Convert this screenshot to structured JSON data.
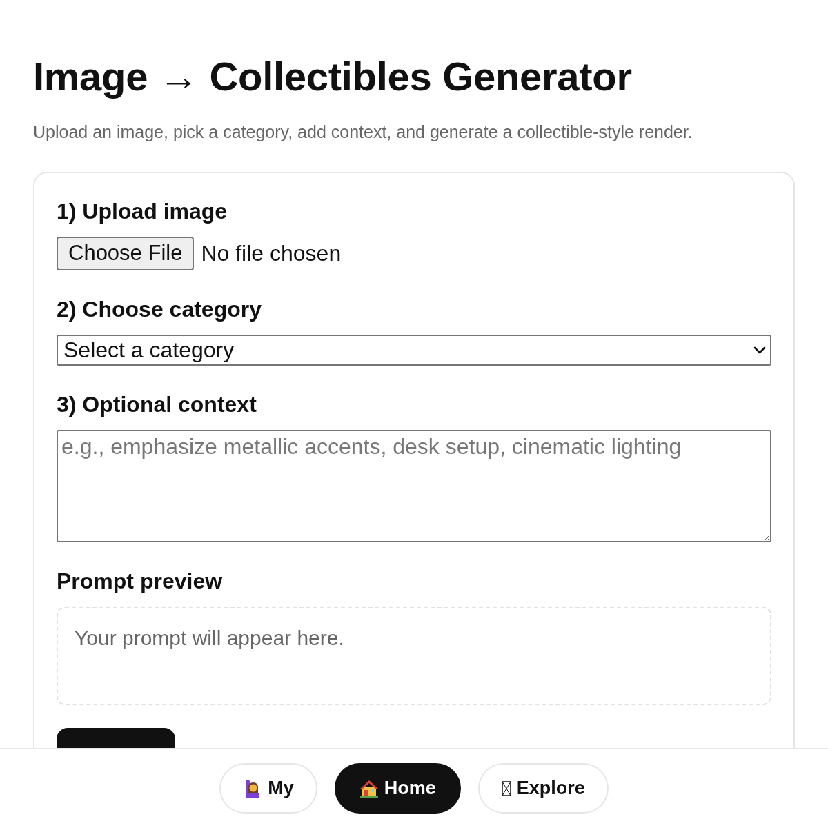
{
  "page": {
    "title": "Image → Collectibles Generator",
    "subtitle": "Upload an image, pick a category, add context, and generate a collectible-style render."
  },
  "form": {
    "upload": {
      "label": "1) Upload image",
      "button": "Choose File",
      "status": "No file chosen"
    },
    "category": {
      "label": "2) Choose category",
      "value": "Select a category"
    },
    "context": {
      "label": "3) Optional context",
      "placeholder": "e.g., emphasize metallic accents, desk setup, cinematic lighting"
    },
    "preview": {
      "label": "Prompt preview",
      "text": "Your prompt will appear here."
    }
  },
  "bottom_nav": [
    {
      "label": "My",
      "selected": false
    },
    {
      "label": "Home",
      "selected": true
    },
    {
      "label": "Explore",
      "selected": false
    }
  ]
}
